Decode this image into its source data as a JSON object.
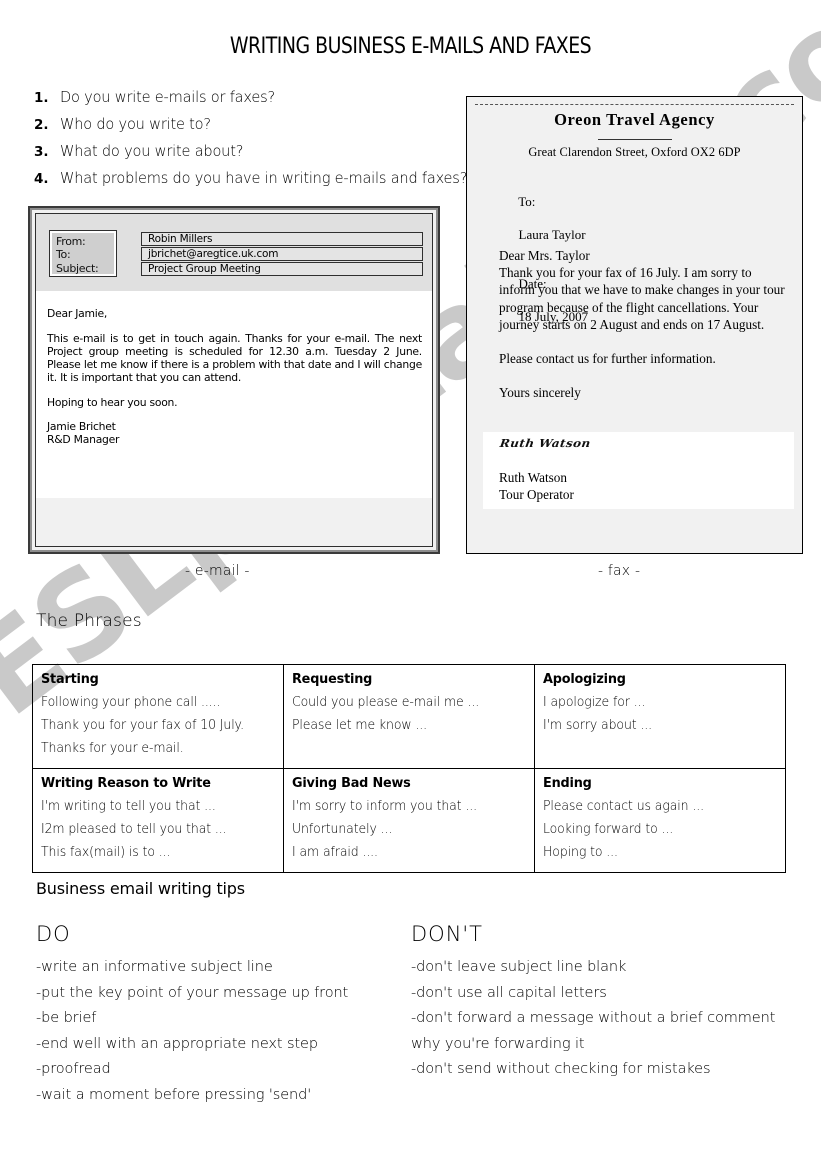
{
  "title": "WRITING BUSINESS E-MAILS AND FAXES",
  "watermark": "ESLprintables.com",
  "questions": [
    {
      "num": "1.",
      "text": "Do you write e-mails or faxes?"
    },
    {
      "num": "2.",
      "text": "Who do you write to?"
    },
    {
      "num": "3.",
      "text": "What do you write about?"
    },
    {
      "num": "4.",
      "text": "What problems do you have in writing e-mails and faxes?"
    }
  ],
  "email": {
    "labels": {
      "from": "From:",
      "to": "To:",
      "subject": "Subject:"
    },
    "fields": {
      "from": "Robin Millers",
      "to": "jbrichet@aregtice.uk.com",
      "subject": "Project Group Meeting"
    },
    "body": {
      "greeting": "Dear Jamie,",
      "paragraph": "This e-mail is to get in touch again. Thanks for your e-mail. The next Project group meeting is scheduled for 12.30 a.m. Tuesday 2 June. Please let me know if there is a problem with that date and I will change it. It is important that you can attend.",
      "closing": "Hoping to hear you soon.",
      "signer_name": "Jamie Brichet",
      "signer_title": "R&D Manager"
    },
    "caption": "- e-mail -"
  },
  "fax": {
    "company": "Oreon Travel Agency",
    "address": "Great Clarendon Street, Oxford OX2 6DP",
    "to_label": "To:",
    "to_value": "Laura Taylor",
    "date_label": "Date:",
    "date_value": "18 July, 2007",
    "greeting": "Dear Mrs. Taylor",
    "paragraph": "Thank you for your fax of 16 July. I am sorry to inform you that we have to make changes in your tour program because of the flight cancellations. Your journey starts on 2 August and ends on 17 August.",
    "contact_line": "Please contact us for further information.",
    "closing": "Yours sincerely",
    "signature": "Ruth Watson",
    "signer_name": "Ruth Watson",
    "signer_title": "Tour Operator",
    "caption": "- fax -"
  },
  "phrases": {
    "heading": "The Phrases",
    "cells": [
      {
        "head": "Starting",
        "lines": [
          "Following your phone call .....",
          "Thank you for your fax of 10 July.",
          "Thanks for your e-mail."
        ]
      },
      {
        "head": "Requesting",
        "lines": [
          "Could you please e-mail me ...",
          "Please let me know ..."
        ]
      },
      {
        "head": "Apologizing",
        "lines": [
          "I apologize for ...",
          "I'm sorry about ..."
        ]
      },
      {
        "head": "Writing Reason to Write",
        "lines": [
          "I'm writing to tell you that ...",
          "I2m pleased to tell you that ...",
          "This fax(mail) is to ..."
        ]
      },
      {
        "head": "Giving Bad News",
        "lines": [
          "I'm sorry to inform you that ...",
          "Unfortunately ...",
          "I am afraid ...."
        ]
      },
      {
        "head": "Ending",
        "lines": [
          "Please contact us again ...",
          "Looking forward to ...",
          "Hoping to ..."
        ]
      }
    ]
  },
  "tips": {
    "heading": "Business email writing tips",
    "do": {
      "title": "DO",
      "lines": [
        "-write an informative subject line",
        "-put the key point of your message up front",
        "-be brief",
        "-end well with an appropriate next step",
        "-proofread",
        "-wait a moment before pressing 'send'"
      ]
    },
    "dont": {
      "title": "DON'T",
      "lines": [
        "-don't leave subject line blank",
        "-don't use all capital letters",
        "-don't forward a message without a brief comment",
        "why you're forwarding it",
        "-don't send without checking for mistakes"
      ]
    }
  }
}
